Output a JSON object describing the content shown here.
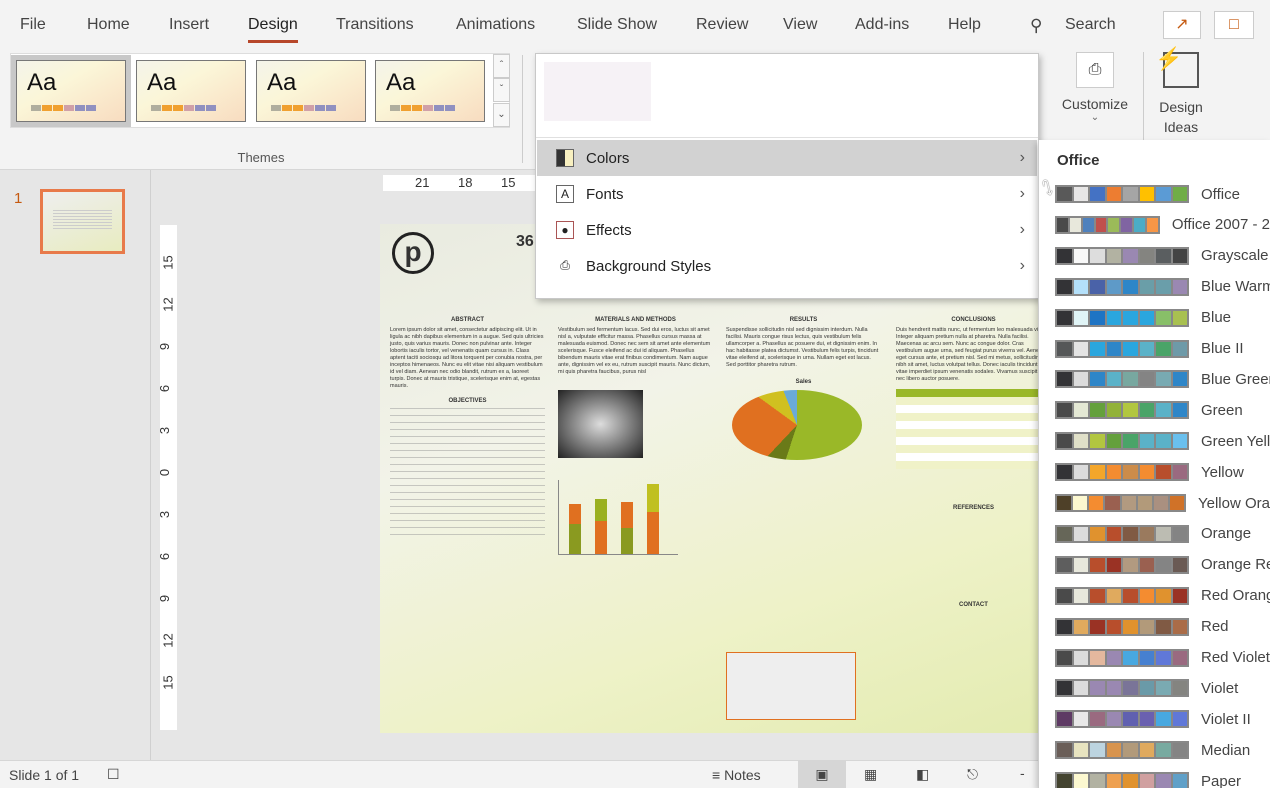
{
  "tabs": [
    "File",
    "Home",
    "Insert",
    "Design",
    "Transitions",
    "Animations",
    "Slide Show",
    "Review",
    "View",
    "Add-ins",
    "Help"
  ],
  "active_tab": "Design",
  "search_label": "Search",
  "themes": {
    "group_label": "Themes",
    "sample": "Aa",
    "swatch_colors": [
      "#b0ae9e",
      "#f0a030",
      "#f0a030",
      "#d0a0a8",
      "#9090c0",
      "#9090c0"
    ]
  },
  "design_menu": {
    "items": [
      {
        "label": "Colors",
        "icon": "colors-icon"
      },
      {
        "label": "Fonts",
        "icon": "fonts-icon"
      },
      {
        "label": "Effects",
        "icon": "effects-icon"
      },
      {
        "label": "Background Styles",
        "icon": "background-styles-icon"
      }
    ],
    "highlighted": "Colors"
  },
  "customize": {
    "label": "Customize",
    "design_ideas": "Design Ideas"
  },
  "colors_submenu": {
    "header": "Office",
    "schemes": [
      {
        "name": "Office",
        "colors": [
          "#595959",
          "#e7e6e6",
          "#4472c4",
          "#ed7d31",
          "#a5a5a5",
          "#ffc000",
          "#5b9bd5",
          "#70ad47"
        ]
      },
      {
        "name": "Office 2007 - 2010",
        "colors": [
          "#4a4a4a",
          "#e8e8dc",
          "#4f81bd",
          "#c0504d",
          "#9bbb59",
          "#8064a2",
          "#4bacc6",
          "#f79646"
        ]
      },
      {
        "name": "Grayscale",
        "colors": [
          "#333336",
          "#f8f8f8",
          "#dddddd",
          "#b2b2a2",
          "#9a88b2",
          "#848480",
          "#5a5e60",
          "#444444"
        ]
      },
      {
        "name": "Blue Warm",
        "colors": [
          "#333336",
          "#b4e0fa",
          "#4a62a8",
          "#5e9ac8",
          "#2e86c8",
          "#6a9ea8",
          "#6a9eaa",
          "#9a88b2"
        ]
      },
      {
        "name": "Blue",
        "colors": [
          "#333336",
          "#e0f4f6",
          "#1e74c4",
          "#2aa6de",
          "#2aa6de",
          "#2aa6de",
          "#88bf68",
          "#a8c050"
        ]
      },
      {
        "name": "Blue II",
        "colors": [
          "#555758",
          "#e4e4e4",
          "#2aa6de",
          "#2e86c8",
          "#2aa6de",
          "#5ab2c8",
          "#4aa468",
          "#6e9aa8"
        ]
      },
      {
        "name": "Blue Green",
        "colors": [
          "#333336",
          "#dcdcdc",
          "#2e86c8",
          "#5ab2c8",
          "#78a8a0",
          "#848484",
          "#78aab2",
          "#2e86c8"
        ]
      },
      {
        "name": "Green",
        "colors": [
          "#4a4a4a",
          "#e4e8d4",
          "#64a03c",
          "#92b238",
          "#b2c640",
          "#4aa468",
          "#5ab2c8",
          "#2e86c8"
        ]
      },
      {
        "name": "Green Yellow",
        "colors": [
          "#4a4a4a",
          "#e0e0c8",
          "#b2c640",
          "#64a03c",
          "#4aa468",
          "#5ab2c8",
          "#5ab2c8",
          "#6ac0ee"
        ]
      },
      {
        "name": "Yellow",
        "colors": [
          "#333336",
          "#dcdcdc",
          "#f4a62a",
          "#f48c30",
          "#cc8c4a",
          "#f48c30",
          "#b84e2c",
          "#9a6a80"
        ]
      },
      {
        "name": "Yellow Orange",
        "colors": [
          "#4e4028",
          "#fcf8d0",
          "#f48c30",
          "#9a6050",
          "#b29a80",
          "#b29a7a",
          "#aa9080",
          "#d07228"
        ]
      },
      {
        "name": "Orange",
        "colors": [
          "#666658",
          "#dcdcdc",
          "#e0922e",
          "#b84e2c",
          "#805a44",
          "#9a7a5e",
          "#bcbcb2",
          "#848484"
        ]
      },
      {
        "name": "Orange Red",
        "colors": [
          "#5e5e5e",
          "#e8e8dc",
          "#b84e2c",
          "#9a3224",
          "#b29a80",
          "#9a6050",
          "#848484",
          "#6a5a54"
        ]
      },
      {
        "name": "Red Orange",
        "colors": [
          "#4a4a4a",
          "#e8e8dc",
          "#b84e2c",
          "#e0aa5e",
          "#b84e2c",
          "#f48c30",
          "#e0922e",
          "#9a3224"
        ]
      },
      {
        "name": "Red",
        "colors": [
          "#333336",
          "#e0aa5e",
          "#9a3224",
          "#b84e2c",
          "#e0922e",
          "#b29a7a",
          "#805a44",
          "#aa6c48"
        ]
      },
      {
        "name": "Red Violet",
        "colors": [
          "#4a4a4a",
          "#dcdcdc",
          "#e4b89e",
          "#9a88b2",
          "#48a8e0",
          "#4680d0",
          "#6078d8",
          "#9a6a80"
        ]
      },
      {
        "name": "Violet",
        "colors": [
          "#333336",
          "#dcdcdc",
          "#9a88b2",
          "#9a88b2",
          "#7a7498",
          "#6a9aa8",
          "#7aaab2",
          "#848480"
        ]
      },
      {
        "name": "Violet II",
        "colors": [
          "#5e3a64",
          "#e8e8e8",
          "#9a6a80",
          "#9a88b2",
          "#6060b0",
          "#6a60b0",
          "#48a8e0",
          "#6078d8"
        ]
      },
      {
        "name": "Median",
        "colors": [
          "#6a5e58",
          "#e8e4c0",
          "#bcd4e0",
          "#d8944e",
          "#b29a7a",
          "#e0aa5e",
          "#78aaa0",
          "#848484"
        ]
      },
      {
        "name": "Paper",
        "colors": [
          "#444430",
          "#fcf8d0",
          "#b2b2a2",
          "#eea050",
          "#e0922e",
          "#d0a0a0",
          "#9a88b2",
          "#60a0c8"
        ]
      }
    ]
  },
  "thumbnail": {
    "number": "1"
  },
  "ruler_h": [
    "21",
    "18",
    "15"
  ],
  "ruler_v": [
    "15",
    "12",
    "9",
    "6",
    "3",
    "0",
    "3",
    "6",
    "9",
    "12",
    "15"
  ],
  "poster": {
    "title_partial": "36",
    "sections": [
      {
        "heading": "ABSTRACT",
        "text": "Lorem ipsum dolor sit amet, consectetur adipiscing elit. Ut in ligula ac nibh dapibus elementum in a augue. Sed quis ultricies justo, quis varius mauris. Donec non pulvinar ante. Integer lobortis iaculis tortor, vel venenatis quam cursus in. Class aptent taciti sociosqu ad litora torquent per conubia nostra, per inceptos himenaeos. Nunc eu elit vitae nisi aliquam vestibulum id vel diam. Aenean nec odio blandit, rutrum ex a, laoreet turpis. Donec at mauris tristique, scelerisque enim at, egestas mauris."
      },
      {
        "heading": "MATERIALS AND METHODS",
        "text": "Vestibulum sed fermentum lacus. Sed dui eros, luctus sit amet nisl a, vulputate efficitur massa. Phasellus cursus massa at malesuada euismod. Donec nec sem sit amet ante elementum scelerisque. Fusce eleifend ac dui id aliquam. Phasellus bibendum mauris vitae erat finibus condimentum. Nam augue ante, dignissim vel ex eu, rutrum suscipit mauris. Nunc dictum, mi quis pharetra faucibus, purus nisl"
      },
      {
        "heading": "RESULTS",
        "text": "Suspendisse sollicitudin nisl sed dignissim interdum. Nulla facilisi. Mauris congue risus lectus, quis vestibulum felis ullamcorper a. Phasellus ac posuere dui, et dignissim enim. In hac habitasse platea dictumst. Vestibulum felis turpis, tincidunt vitae eleifend at, scelerisque in urna. Nullam eget est lacus. Sed porttitor pharetra rutrum."
      },
      {
        "heading": "CONCLUSIONS",
        "text": "Duis hendrerit mattis nunc, ut fermentum leo malesuada vitae. Integer aliquam pretium nulla at pharetra. Nulla facilisi. Maecenas ac arcu sem. Nunc ac congue dolor. Cras vestibulum augue urna, sed feugiat purus viverra vel. Aenean eget cursus ante, et pretium nisl. Sed mi metus, sollicitudin ut nibh sit amet, luctus volutpat tellus. Donec iaculis tincidunt mi, vitae imperdiet ipsum venenatis sodales. Vivamus suscipit velit nec libero auctor posuere."
      }
    ],
    "chart_label": "Sales",
    "references": "REFERENCES",
    "contact": "CONTACT",
    "objectives": "OBJECTIVES"
  },
  "status": {
    "slide": "Slide 1 of 1",
    "notes": "Notes"
  }
}
